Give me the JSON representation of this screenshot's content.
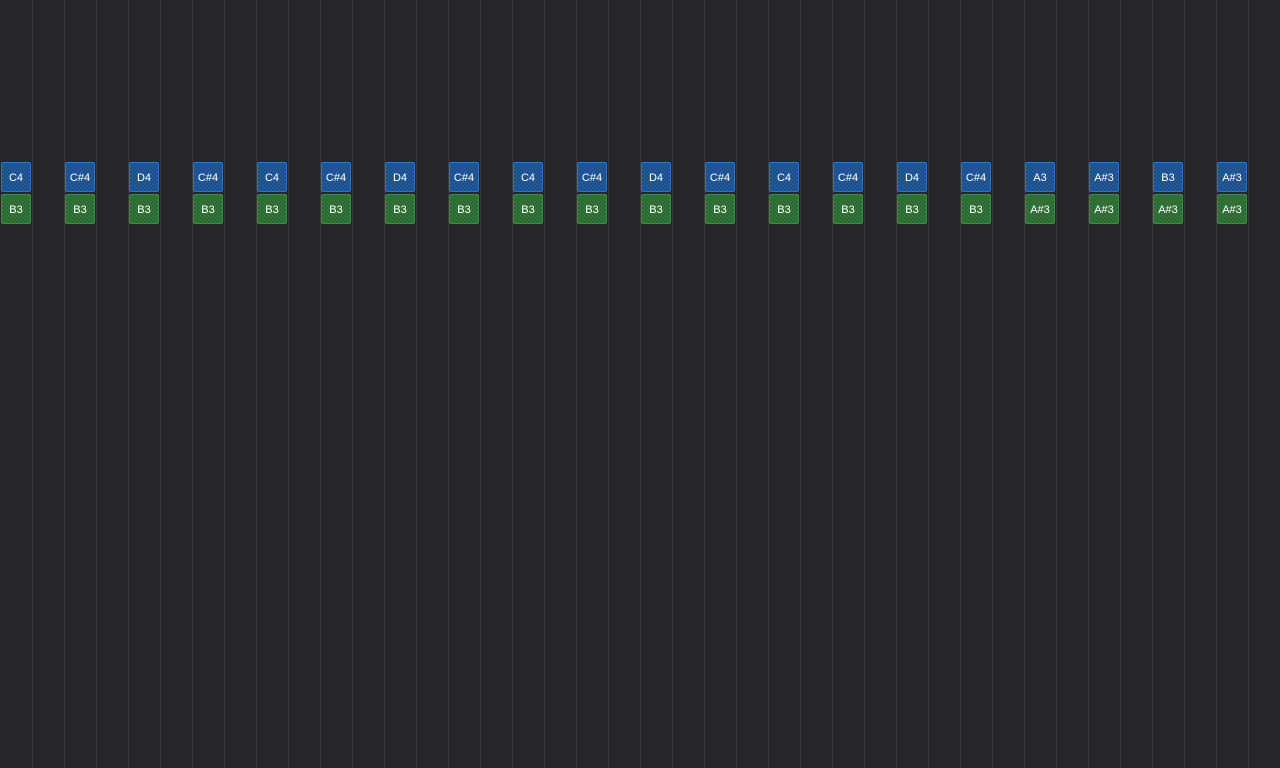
{
  "colors": {
    "background": "#262628",
    "grid_line": "#3a3a3d",
    "upper_note": "#1a4f8f",
    "lower_note": "#2a6a31"
  },
  "steps": [
    {
      "upper": "C4",
      "lower": "B3"
    },
    {
      "upper": "C#4",
      "lower": "B3"
    },
    {
      "upper": "D4",
      "lower": "B3"
    },
    {
      "upper": "C#4",
      "lower": "B3"
    },
    {
      "upper": "C4",
      "lower": "B3"
    },
    {
      "upper": "C#4",
      "lower": "B3"
    },
    {
      "upper": "D4",
      "lower": "B3"
    },
    {
      "upper": "C#4",
      "lower": "B3"
    },
    {
      "upper": "C4",
      "lower": "B3"
    },
    {
      "upper": "C#4",
      "lower": "B3"
    },
    {
      "upper": "D4",
      "lower": "B3"
    },
    {
      "upper": "C#4",
      "lower": "B3"
    },
    {
      "upper": "C4",
      "lower": "B3"
    },
    {
      "upper": "C#4",
      "lower": "B3"
    },
    {
      "upper": "D4",
      "lower": "B3"
    },
    {
      "upper": "C#4",
      "lower": "B3"
    },
    {
      "upper": "A3",
      "lower": "A#3"
    },
    {
      "upper": "A#3",
      "lower": "A#3"
    },
    {
      "upper": "B3",
      "lower": "A#3"
    },
    {
      "upper": "A#3",
      "lower": "A#3"
    }
  ]
}
